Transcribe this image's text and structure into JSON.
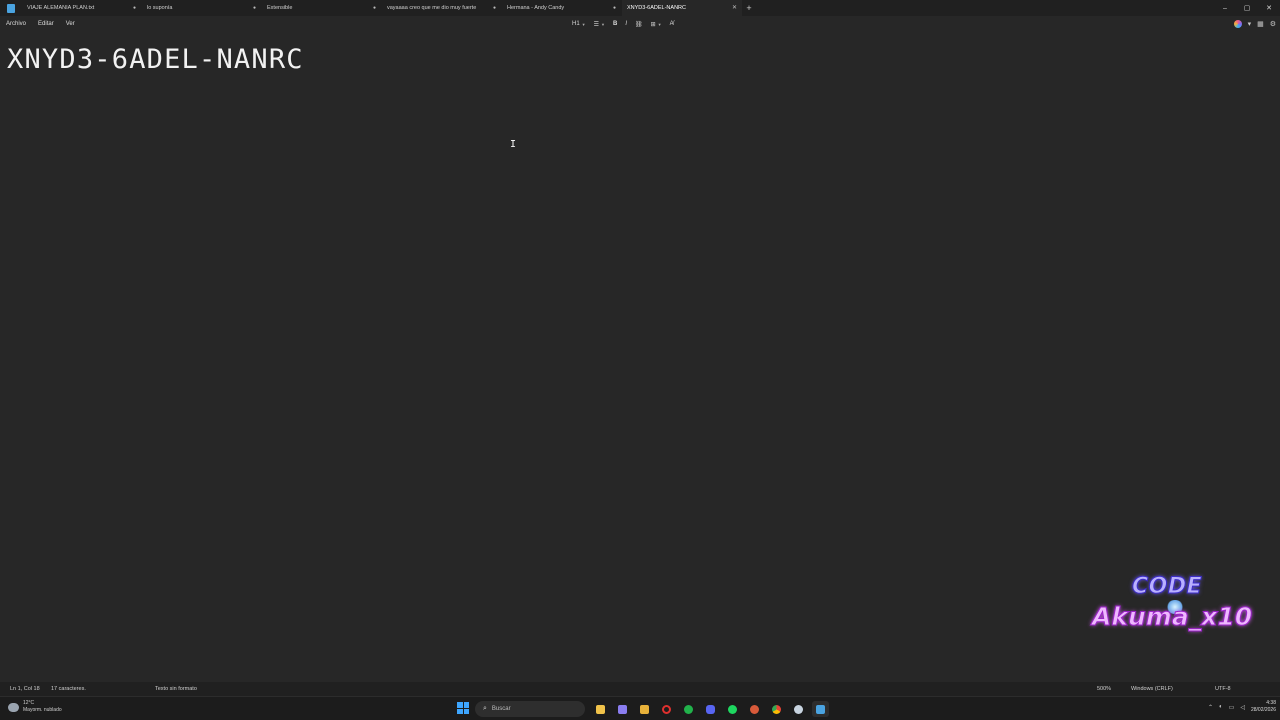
{
  "tabs": [
    {
      "label": "VIAJE ALEMANIA PLAN.txt",
      "modified": true
    },
    {
      "label": "lo suponía",
      "modified": true
    },
    {
      "label": "Extensible",
      "modified": true
    },
    {
      "label": "vayaaaa creo que me dio muy fuerte",
      "modified": true
    },
    {
      "label": "Hermana - Andy Candy",
      "modified": true
    },
    {
      "label": "XNYD3-6ADEL-NANRC",
      "modified": false,
      "active": true
    }
  ],
  "tab_icons": {
    "close": "✕",
    "dot": "●",
    "new_tab": "+"
  },
  "window_controls": {
    "minimize": "–",
    "maximize": "▢",
    "close": "✕"
  },
  "menu": {
    "archivo": "Archivo",
    "editar": "Editar",
    "ver": "Ver"
  },
  "toolbar": {
    "heading": "H1",
    "list": "☰",
    "bold": "B",
    "italic": "I",
    "link": "⛓",
    "table": "⊞",
    "clear_format": "A̸"
  },
  "document": {
    "content": "XNYD3-6ADEL-NANRC"
  },
  "cursor_glyph": "I",
  "watermark": {
    "line1": "CODE",
    "line2": "Akuma_x10"
  },
  "statusbar": {
    "position": "Ln 1, Col 18",
    "characters": "17 caracteres.",
    "format": "Texto sin formato",
    "zoom": "500%",
    "line_endings": "Windows (CRLF)",
    "encoding": "UTF-8"
  },
  "taskbar": {
    "weather_temp": "12°C",
    "weather_desc": "Mayorm. nublado",
    "search_placeholder": "Buscar",
    "time": "4:38",
    "date": "28/02/2026",
    "apps": [
      {
        "name": "file-explorer-icon",
        "color": "#f0c24a"
      },
      {
        "name": "photos-icon",
        "color": "#8a7df0"
      },
      {
        "name": "files-icon",
        "color": "#e8b23a"
      },
      {
        "name": "opera-icon",
        "color": "#e0302e"
      },
      {
        "name": "xbox-icon",
        "color": "#21b24b"
      },
      {
        "name": "discord-icon",
        "color": "#5865f2"
      },
      {
        "name": "spotify-icon",
        "color": "#1ed760"
      },
      {
        "name": "davinci-icon",
        "color": "#d85a3a"
      },
      {
        "name": "chrome-icon",
        "color": "#f2b233"
      },
      {
        "name": "steam-icon",
        "color": "#c8d4e0"
      },
      {
        "name": "notepad-icon",
        "color": "#4aa3e0"
      }
    ]
  },
  "colors": {
    "background": "#272727",
    "chrome": "#202020",
    "accent": "#3ea6ff"
  }
}
